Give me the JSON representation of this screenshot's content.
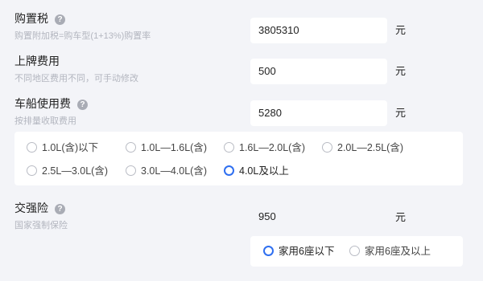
{
  "purchase_tax": {
    "label": "购置税",
    "help_icon": "?",
    "desc": "购置附加税=购车型(1+13%)购置率",
    "value": "3805310",
    "unit": "元"
  },
  "plate_fee": {
    "label": "上牌费用",
    "desc": "不同地区费用不同，可手动修改",
    "value": "500",
    "unit": "元"
  },
  "vehicle_tax": {
    "label": "车船使用费",
    "help_icon": "?",
    "desc": "按排量收取费用",
    "value": "5280",
    "unit": "元",
    "options": [
      "1.0L(含)以下",
      "1.0L—1.6L(含)",
      "1.6L—2.0L(含)",
      "2.0L—2.5L(含)",
      "2.5L—3.0L(含)",
      "3.0L—4.0L(含)",
      "4.0L及以上"
    ],
    "selected": "4.0L及以上"
  },
  "insurance": {
    "label": "交强险",
    "help_icon": "?",
    "desc": "国家强制保险",
    "value": "950",
    "unit": "元",
    "options": [
      "家用6座以下",
      "家用6座及以上"
    ],
    "selected": "家用6座以下"
  },
  "colors": {
    "accent": "#2f6ff0",
    "background": "#f3f4f8",
    "muted": "#b3b6bf"
  }
}
